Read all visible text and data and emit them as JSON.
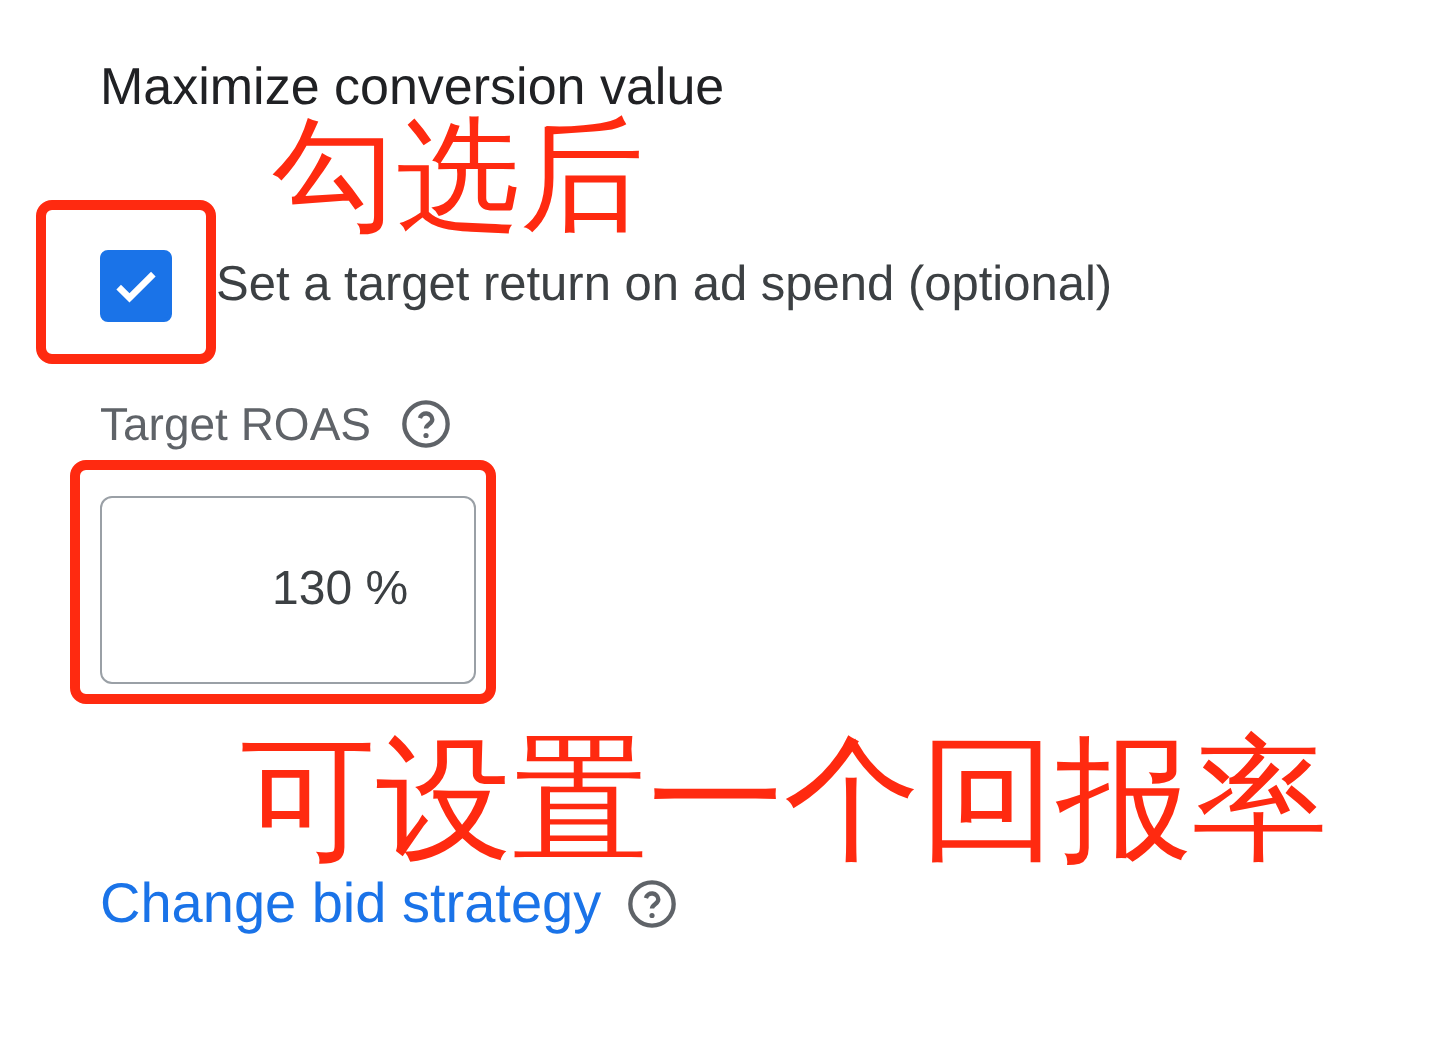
{
  "heading": "Maximize conversion value",
  "target_roas_checkbox": {
    "label": "Set a target return on ad spend (optional)",
    "checked": true
  },
  "target_roas": {
    "label": "Target ROAS",
    "value": "130",
    "unit": "%"
  },
  "link": "Change bid strategy",
  "annotations": [
    {
      "text": "勾选后"
    },
    {
      "text": "可设置一个回报率"
    }
  ]
}
